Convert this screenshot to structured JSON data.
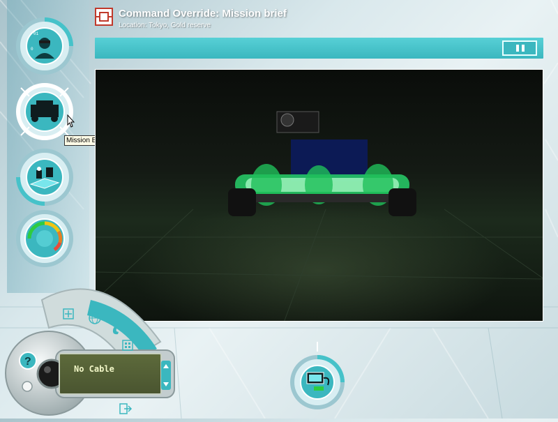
{
  "header": {
    "title": "Command Override: Mission brief",
    "subtitle": "Location: Tokyo, Gold reserve",
    "pause_label": "pause-icon"
  },
  "nav": {
    "items": [
      {
        "name": "profile",
        "icon": "agent-profile-icon"
      },
      {
        "name": "mission-brief",
        "icon": "vehicle-icon",
        "tooltip": "Mission Brief"
      },
      {
        "name": "building",
        "icon": "build-icon"
      },
      {
        "name": "status",
        "icon": "gauge-icon"
      }
    ]
  },
  "tooltip": "Mission Brief",
  "console": {
    "display_text": "No Cable",
    "help_label": "?",
    "icons": [
      "crosshair-icon",
      "globe-icon",
      "phone-icon",
      "building-icon",
      "exit-icon",
      "scroll-arrows-icon"
    ]
  },
  "computer_button": {
    "icon": "computer-icon"
  },
  "colors": {
    "accent": "#3bb7bf",
    "accent_light": "#57d0d6",
    "lcd": "#4a5530",
    "lcd_text": "#f2f7c8",
    "header_icon": "#c0392b"
  }
}
